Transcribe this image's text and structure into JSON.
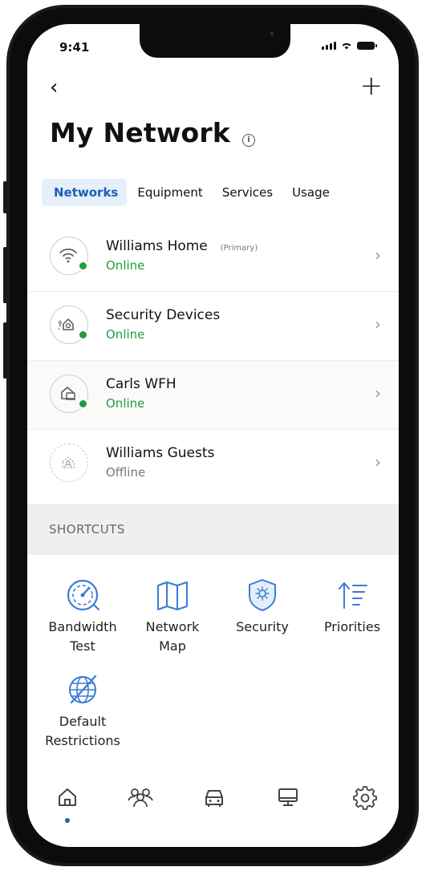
{
  "status_bar": {
    "time": "9:41"
  },
  "header": {
    "title": "My Network",
    "info_icon": "info-icon"
  },
  "tabs": [
    {
      "label": "Networks",
      "active": true
    },
    {
      "label": "Equipment",
      "active": false
    },
    {
      "label": "Services",
      "active": false
    },
    {
      "label": "Usage",
      "active": false
    }
  ],
  "networks": [
    {
      "name": "Williams Home",
      "tag": "(Primary)",
      "status": "Online",
      "icon": "wifi-icon"
    },
    {
      "name": "Security Devices",
      "status": "Online",
      "icon": "security-home-icon"
    },
    {
      "name": "Carls WFH",
      "status": "Online",
      "icon": "home-office-icon"
    },
    {
      "name": "Williams Guests",
      "status": "Offline",
      "icon": "guest-network-icon"
    }
  ],
  "shortcuts": {
    "header": "SHORTCUTS",
    "items": [
      {
        "label1": "Bandwidth",
        "label2": "Test",
        "icon": "speedometer-icon"
      },
      {
        "label1": "Network",
        "label2": "Map",
        "icon": "map-icon"
      },
      {
        "label1": "Security",
        "label2": "",
        "icon": "shield-icon"
      },
      {
        "label1": "Priorities",
        "label2": "",
        "icon": "priorities-icon"
      },
      {
        "label1": "Default",
        "label2": "Restrictions",
        "icon": "restricted-globe-icon"
      }
    ]
  },
  "bottom_nav": [
    "home-icon",
    "people-icon",
    "car-icon",
    "devices-icon",
    "settings-icon"
  ],
  "colors": {
    "accent": "#1b5fb5",
    "online": "#1f9e3f",
    "offline": "#777777",
    "icon_blue": "#3a7bd5"
  }
}
